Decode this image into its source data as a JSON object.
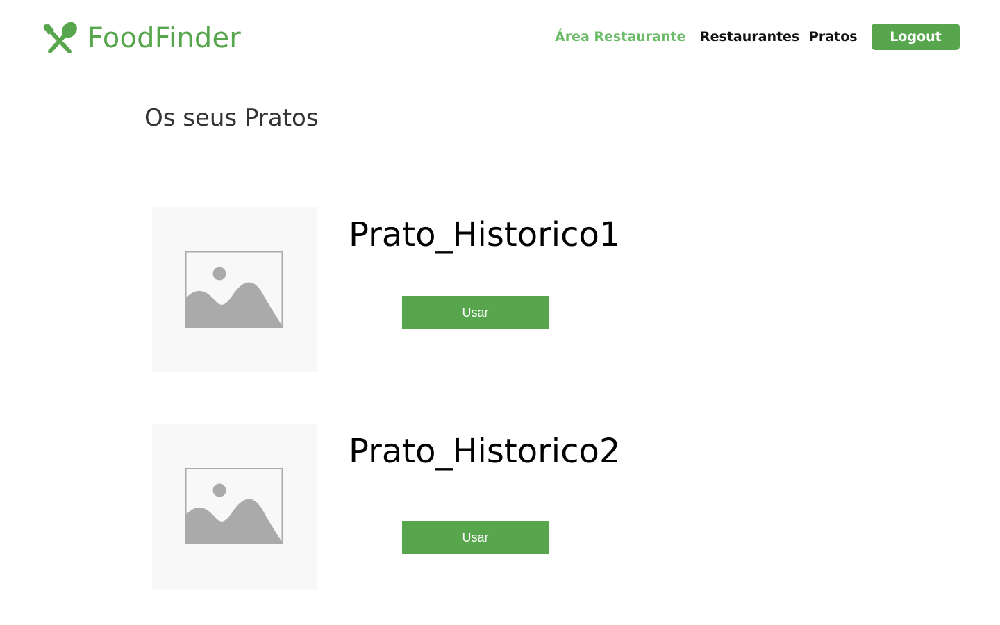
{
  "header": {
    "brand": "FoodFinder",
    "brand_icon": "fork-and-spoon-icon",
    "nav": [
      {
        "label": "Área Restaurante",
        "active": true
      },
      {
        "label": "Restaurantes",
        "active": false
      },
      {
        "label": "Pratos",
        "active": false
      }
    ],
    "logout_label": "Logout"
  },
  "main": {
    "title": "Os seus Pratos",
    "dishes": [
      {
        "name": "Prato_Historico1",
        "image_icon": "image-placeholder-icon",
        "button_label": "Usar"
      },
      {
        "name": "Prato_Historico2",
        "image_icon": "image-placeholder-icon",
        "button_label": "Usar"
      }
    ]
  },
  "colors": {
    "brand": "#57a64e",
    "nav_active": "#6cbb69",
    "nav_default": "#111111",
    "title": "#333333",
    "image_bg": "#f8f8f8",
    "placeholder": "#aaaaaa"
  }
}
